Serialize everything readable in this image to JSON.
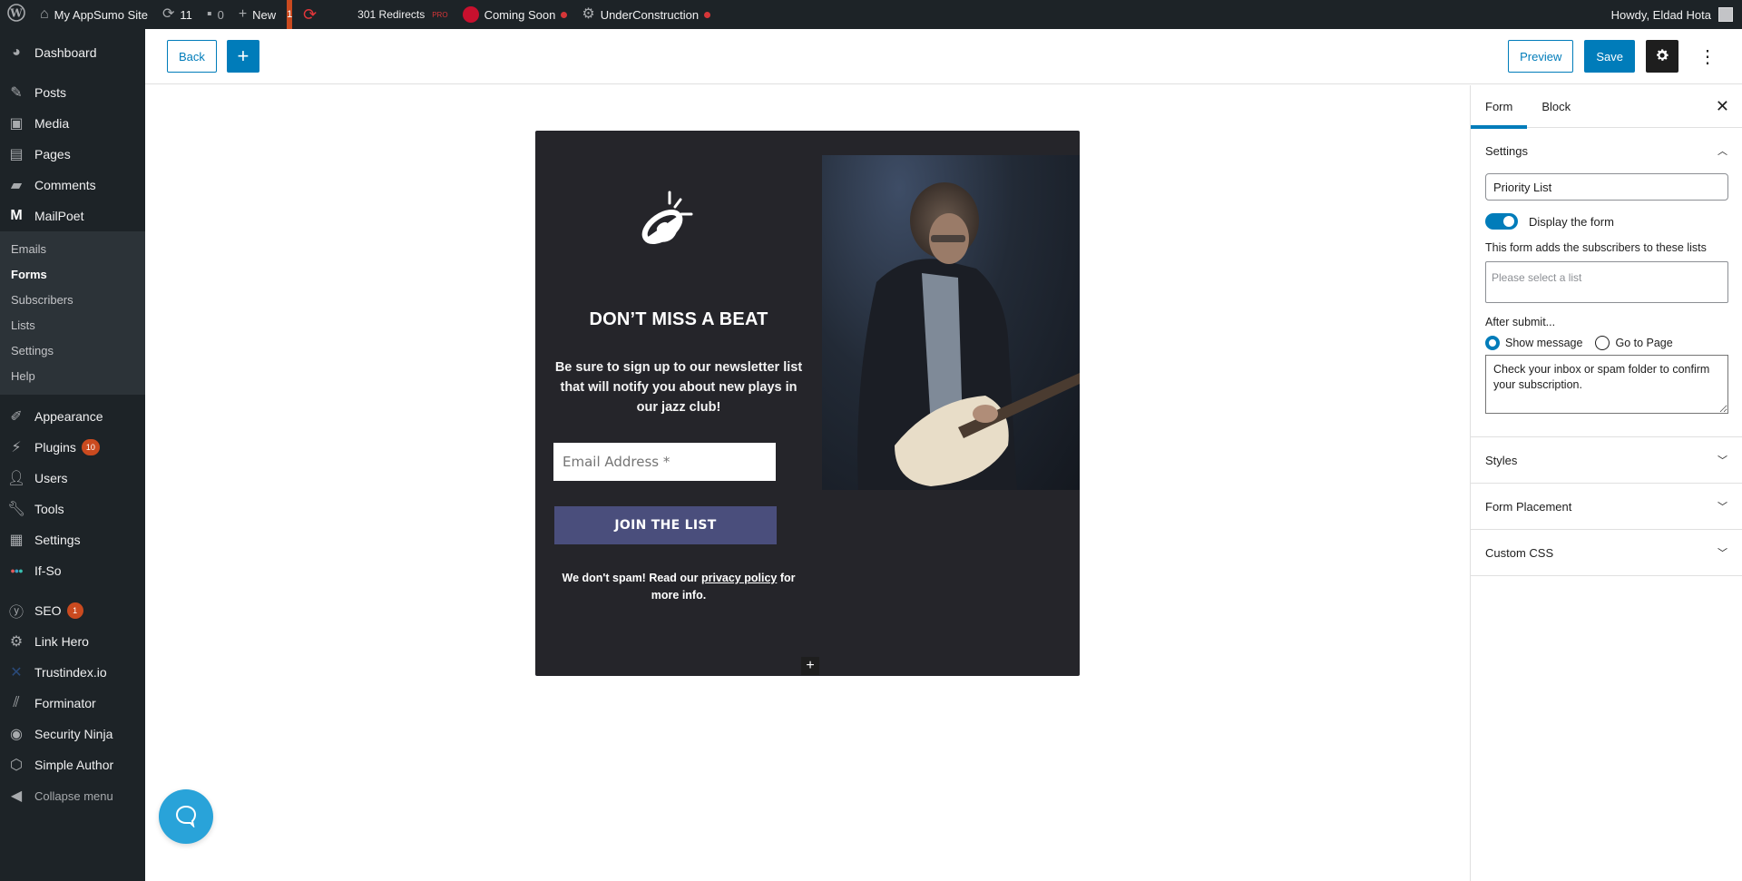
{
  "admin_bar": {
    "site_name": "My AppSumo Site",
    "updates_count": "11",
    "comments_count": "0",
    "new_label": "New",
    "notice_count": "1",
    "redirects_label": "301 Redirects",
    "redirects_badge": "PRO",
    "coming_soon_label": "Coming Soon",
    "under_construction_label": "UnderConstruction",
    "greeting": "Howdy, Eldad Hota"
  },
  "sidebar": {
    "items_top": [
      {
        "label": "Dashboard",
        "icon": "dashboard-icon"
      }
    ],
    "items_main": [
      {
        "label": "Posts",
        "icon": "pin-icon"
      },
      {
        "label": "Media",
        "icon": "media-icon"
      },
      {
        "label": "Pages",
        "icon": "pages-icon"
      },
      {
        "label": "Comments",
        "icon": "comment-icon"
      },
      {
        "label": "MailPoet",
        "icon": "mailpoet-icon"
      }
    ],
    "mailpoet_submenu": [
      {
        "label": "Emails"
      },
      {
        "label": "Forms",
        "current": true
      },
      {
        "label": "Subscribers"
      },
      {
        "label": "Lists"
      },
      {
        "label": "Settings"
      },
      {
        "label": "Help"
      }
    ],
    "items_bottom": [
      {
        "label": "Appearance",
        "icon": "brush-icon"
      },
      {
        "label": "Plugins",
        "icon": "plugin-icon",
        "badge": "10"
      },
      {
        "label": "Users",
        "icon": "user-icon"
      },
      {
        "label": "Tools",
        "icon": "wrench-icon"
      },
      {
        "label": "Settings",
        "icon": "settings-icon"
      },
      {
        "label": "If-So",
        "icon": "ifso-icon"
      }
    ],
    "items_plugins": [
      {
        "label": "SEO",
        "icon": "yoast-icon",
        "badge": "1"
      },
      {
        "label": "Link Hero",
        "icon": "gear-icon"
      },
      {
        "label": "Trustindex.io",
        "icon": "trustindex-icon"
      },
      {
        "label": "Forminator",
        "icon": "forminator-icon"
      },
      {
        "label": "Security Ninja",
        "icon": "ninja-icon"
      },
      {
        "label": "Simple Author",
        "icon": "author-icon"
      }
    ],
    "collapse_label": "Collapse menu"
  },
  "editor_header": {
    "back_label": "Back",
    "add_label": "+",
    "preview_label": "Preview",
    "save_label": "Save",
    "more_label": "⋮"
  },
  "form_preview": {
    "title": "DON’T MISS A BEAT",
    "description": "Be sure to sign up to our newsletter list that will notify you about new plays in our jazz club!",
    "email_placeholder": "Email Address *",
    "submit_label": "JOIN THE LIST",
    "spam_prefix": "We don't spam! Read our ",
    "privacy_link": "privacy policy",
    "spam_suffix": " for more info.",
    "add_block_label": "+",
    "colors": {
      "background": "#25252a",
      "button": "#4a4e7c"
    }
  },
  "panel": {
    "tabs": [
      {
        "label": "Form",
        "active": true
      },
      {
        "label": "Block",
        "active": false
      }
    ],
    "close_label": "✕",
    "settings": {
      "title": "Settings",
      "form_name": "Priority List",
      "display_toggle_label": "Display the form",
      "display_enabled": true,
      "lists_label": "This form adds the subscribers to these lists",
      "lists_placeholder": "Please select a list",
      "after_submit_label": "After submit...",
      "radio_show_message": "Show message",
      "radio_go_to_page": "Go to Page",
      "selected_option": "Show message",
      "message_text": "Check your inbox or spam folder to confirm your subscription."
    },
    "sections": [
      {
        "title": "Styles"
      },
      {
        "title": "Form Placement"
      },
      {
        "title": "Custom CSS"
      }
    ]
  },
  "accent_color": "#007cba"
}
